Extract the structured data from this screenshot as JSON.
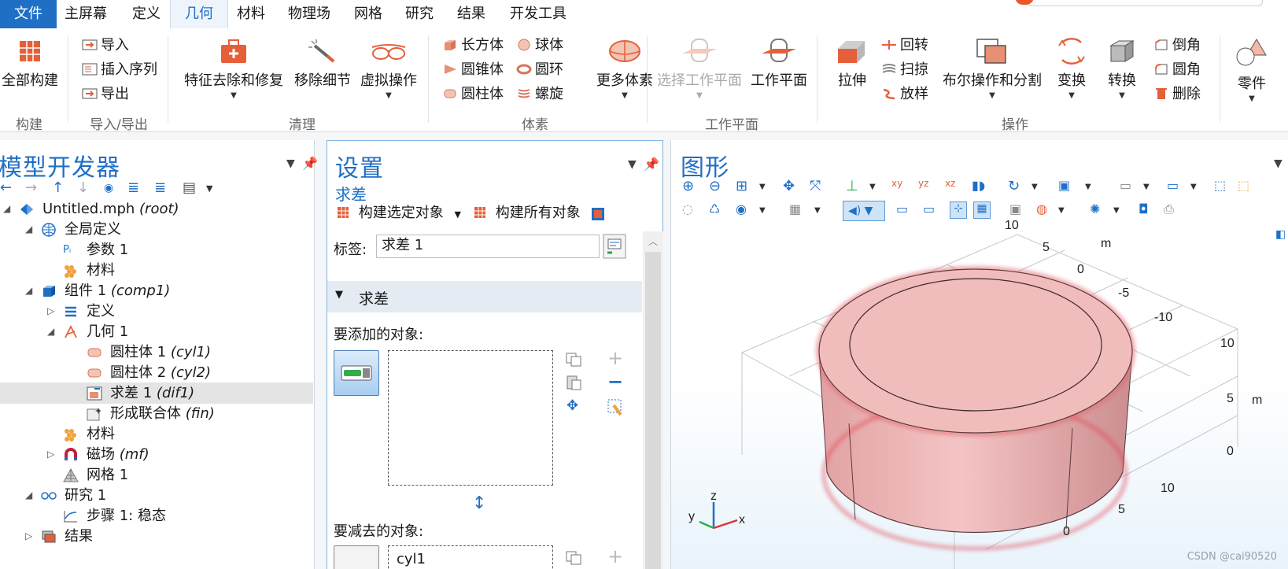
{
  "menu": {
    "tabs": [
      "文件",
      "主屏幕",
      "定义",
      "几何",
      "材料",
      "物理场",
      "网格",
      "研究",
      "结果",
      "开发工具"
    ],
    "active": "几何"
  },
  "ribbon": {
    "groups": {
      "build": "构建",
      "import_export": "导入/导出",
      "cleanup": "清理",
      "primitives": "体素",
      "workplane": "工作平面",
      "operations": "操作"
    },
    "build_all": "全部构建",
    "import": "导入",
    "insert_sequence": "插入序列",
    "export": "导出",
    "defeaturing": "特征去除和修复",
    "remove_details": "移除细节",
    "virtual_ops": "虚拟操作",
    "block": "长方体",
    "sphere": "球体",
    "cone": "圆锥体",
    "torus": "圆环",
    "cylinder": "圆柱体",
    "helix": "螺旋",
    "more_primitives": "更多体素",
    "select_workplane": "选择工作平面",
    "workplane": "工作平面",
    "extrude": "拉伸",
    "revolve": "回转",
    "sweep": "扫掠",
    "loft": "放样",
    "booleans": "布尔操作和分割",
    "transforms": "变换",
    "conversions": "转换",
    "chamfer": "倒角",
    "fillet": "圆角",
    "delete": "删除",
    "parts": "零件"
  },
  "model_builder": {
    "title": "模型开发器",
    "tree": [
      {
        "label": "Untitled.mph",
        "tag": "(root)"
      },
      {
        "label": "全局定义",
        "tag": ""
      },
      {
        "label": "参数 1",
        "tag": ""
      },
      {
        "label": "材料",
        "tag": ""
      },
      {
        "label": "组件 1",
        "tag": "(comp1)"
      },
      {
        "label": "定义",
        "tag": ""
      },
      {
        "label": "几何 1",
        "tag": ""
      },
      {
        "label": "圆柱体 1",
        "tag": "(cyl1)"
      },
      {
        "label": "圆柱体 2",
        "tag": "(cyl2)"
      },
      {
        "label": "求差 1",
        "tag": "(dif1)"
      },
      {
        "label": "形成联合体",
        "tag": "(fin)"
      },
      {
        "label": "材料",
        "tag": ""
      },
      {
        "label": "磁场",
        "tag": "(mf)"
      },
      {
        "label": "网格 1",
        "tag": ""
      },
      {
        "label": "研究 1",
        "tag": ""
      },
      {
        "label": "步骤 1: 稳态",
        "tag": ""
      },
      {
        "label": "结果",
        "tag": ""
      }
    ]
  },
  "settings": {
    "title": "设置",
    "subtitle": "求差",
    "build_selected": "构建选定对象",
    "build_all": "构建所有对象",
    "label_caption": "标签:",
    "label_value": "求差 1",
    "section": "求差",
    "objects_to_add": "要添加的对象:",
    "objects_to_subtract": "要减去的对象:",
    "subtract_value": "cyl1"
  },
  "graphics": {
    "title": "图形",
    "axis_unit": "m",
    "ticks_back_y": [
      "10",
      "5",
      "0",
      "-5",
      "-10"
    ],
    "ticks_right_z": [
      "10",
      "5",
      "0"
    ],
    "ticks_front_x": [
      "10",
      "5",
      "0"
    ],
    "triad": {
      "x": "x",
      "y": "y",
      "z": "z"
    },
    "colors": {
      "body": "#f1b9b9",
      "body_dark": "#d89a9c",
      "highlight": "#e0424f"
    }
  },
  "watermark": "CSDN @cai90520"
}
